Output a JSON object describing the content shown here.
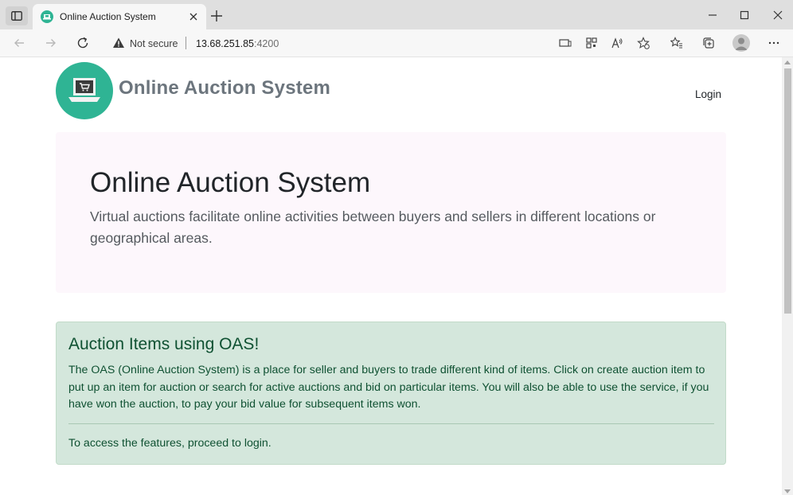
{
  "browser": {
    "tab_title": "Online Auction System",
    "not_secure_label": "Not secure",
    "url_host": "13.68.251.85",
    "url_port": ":4200"
  },
  "header": {
    "brand": "Online Auction System",
    "login_label": "Login"
  },
  "hero": {
    "title": "Online Auction System",
    "lead": "Virtual auctions facilitate online activities between buyers and sellers in different locations or geographical areas."
  },
  "alert": {
    "heading": "Auction Items using OAS!",
    "body": "The OAS (Online Auction System) is a place for seller and buyers to trade different kind of items. Click on create auction item to put up an item for auction or search for active auctions and bid on particular items. You will also be able to use the service, if you have won the auction, to pay your bid value for subsequent items won.",
    "footer": "To access the features, proceed to login."
  },
  "colors": {
    "brand_teal": "#2fb494",
    "hero_bg": "#fdf7fc",
    "alert_bg": "#d4e7dc",
    "alert_text": "#0f5132"
  },
  "icons": {
    "sidebar_toggle": "sidebar-toggle-icon",
    "tab_favicon": "auction-favicon-icon",
    "tab_close": "close-icon",
    "new_tab": "plus-icon",
    "minimize": "minimize-icon",
    "maximize": "maximize-icon",
    "close_window": "close-icon",
    "back": "back-arrow-icon",
    "forward": "forward-arrow-icon",
    "refresh": "refresh-icon",
    "warning": "warning-icon",
    "logo": "shopping-cart-laptop-icon"
  }
}
